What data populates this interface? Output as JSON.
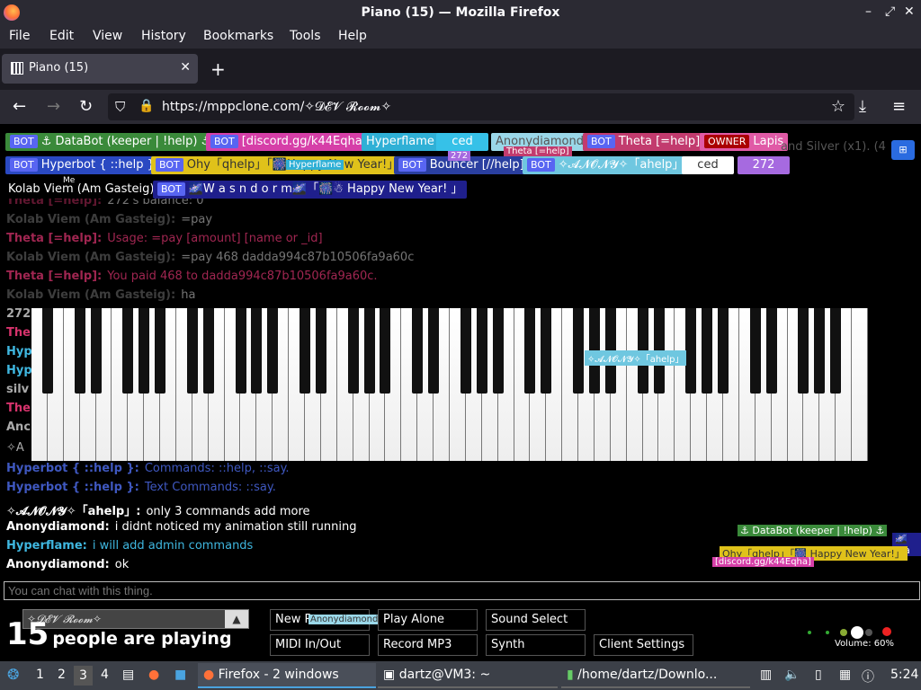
{
  "window": {
    "title": "Piano (15) — Mozilla Firefox"
  },
  "menu": [
    "File",
    "Edit",
    "View",
    "History",
    "Bookmarks",
    "Tools",
    "Help"
  ],
  "tab": {
    "label": "Piano (15)"
  },
  "address": {
    "url": "https://mppclone.com/✧𝓓𝓔𝓥 𝓡𝓸𝓸𝓶✧"
  },
  "users_row1": [
    {
      "label": "⚓ DataBot (keeper | !help) ⚓",
      "bot": true,
      "bg": "#3a8a3a"
    },
    {
      "label": "[discord.gg/k44Eqha]",
      "bot": true,
      "bg": "#d63fa8"
    },
    {
      "label": "Hyperflame",
      "bot": false,
      "bg": "#2fb0d6"
    },
    {
      "label": "ced",
      "bot": false,
      "bg": "#36c1e8"
    },
    {
      "label": "Anonydiamond",
      "bot": false,
      "bg": "#9ad7e8"
    },
    {
      "label": "Theta [=help]",
      "bot": true,
      "bg": "#c23b6e"
    },
    {
      "label": "Lapis",
      "owner": true,
      "bg": "#e05aa6"
    }
  ],
  "users_row2": [
    {
      "label": "Hyperbot { ::help }",
      "bot": true,
      "bg": "#2a49c2"
    },
    {
      "label": "Ohy「qhelp」「🎆Happy New Year!」",
      "bot": true,
      "bg": "#e0c21a"
    },
    {
      "label": "Bouncer [//help]",
      "bot": true,
      "bg": "#2a3fa0"
    },
    {
      "label": "✧𝓐𝓝𝓞𝓝𝓨✧「ahelp」",
      "bot": true,
      "bg": "#6fc7e0"
    },
    {
      "label": "ced",
      "bot": false,
      "bg": "#ffffff"
    },
    {
      "label": "272",
      "bot": false,
      "bg": "#a66ae0"
    }
  ],
  "users_row3": [
    {
      "label": "Kolab Viem (Am Gasteig)",
      "bot": false,
      "bg": "#000000"
    },
    {
      "label": "🌌W a s n d o r m🌌「🎆☃ Happy New Year! 」",
      "bot": true,
      "bg": "#1f1f8c"
    }
  ],
  "me_label": "Me",
  "top_right_text": "and Silver (x1). (4",
  "cursor_labels": {
    "theta": "Theta [=help]",
    "num272": "272",
    "anony_piano": "✧𝓐𝓝𝓞𝓝𝓨✧「ahelp」",
    "hyperflame_small": "Hyperflame",
    "databot_br": "⚓ DataBot (keeper | !help) ⚓",
    "ohy_br": "Ohy「qhelp」「🎆 Happy New Year!」",
    "discord_br": "[discord.gg/k44Eqha]",
    "wa_br": "🌌Wa",
    "anonydiamond_btn": "Anonydiamond"
  },
  "chat_faded": [
    {
      "name": "Theta [=help]:",
      "text": "272's balance: 0",
      "color": "#d6336c"
    },
    {
      "name": "Kolab Viem (Am Gasteig):",
      "text": "=pay",
      "color": "#888888"
    },
    {
      "name": "Theta [=help]:",
      "text": "Usage: =pay [amount] [name or _id]",
      "color": "#d6336c"
    },
    {
      "name": "Kolab Viem (Am Gasteig):",
      "text": "=pay 468 dadda994c87b10506fa9a60c",
      "color": "#888888"
    },
    {
      "name": "Theta [=help]:",
      "text": "You paid 468 to dadda994c87b10506fa9a60c.",
      "color": "#d6336c"
    },
    {
      "name": "Kolab Viem (Am Gasteig):",
      "text": "ha",
      "color": "#888888"
    }
  ],
  "chat_side_stubs": [
    "272",
    "The",
    "Hyp",
    "Hyp",
    "silv",
    "The",
    "Anc",
    "✧A"
  ],
  "chat": [
    {
      "name": "Hyperbot { ::help }:",
      "text": "Commands: ::help, ::say.",
      "color": "#4f6ef0",
      "dim": true
    },
    {
      "name": "Hyperbot { ::help }:",
      "text": "Text Commands: ::say.",
      "color": "#4f6ef0",
      "dim": true
    },
    {
      "name": "✧𝓐𝓝𝓞𝓝𝓨✧「ahelp」:",
      "text": "only 3 commands add more",
      "color": "#ffffff",
      "dim": false
    },
    {
      "name": "Anonydiamond:",
      "text": "i didnt noticed my animation still running",
      "color": "#ffffff",
      "dim": false
    },
    {
      "name": "Hyperflame:",
      "text": "i will add admin commands",
      "color": "#3fb7e0",
      "dim": false
    },
    {
      "name": "Anonydiamond:",
      "text": "ok",
      "color": "#ffffff",
      "dim": false
    }
  ],
  "chat_input": {
    "placeholder": "You can chat with this thing."
  },
  "room_select": "✧𝓓𝓔𝓥 𝓡𝓸𝓸𝓶✧",
  "player_count": {
    "number": "15",
    "text": "people are playing"
  },
  "buttons": {
    "new_room": "New R",
    "play_alone": "Play Alone",
    "sound_select": "Sound Select",
    "midi": "MIDI In/Out",
    "record": "Record MP3",
    "synth": "Synth",
    "client_settings": "Client Settings"
  },
  "volume": "Volume: 60%",
  "taskbar": {
    "workspaces": [
      "1",
      "2",
      "3",
      "4"
    ],
    "firefox_task": "Firefox - 2 windows",
    "terminal_task": "dartz@VM3: ~",
    "files_task": "/home/dartz/Downlo...",
    "clock": "5:24"
  }
}
